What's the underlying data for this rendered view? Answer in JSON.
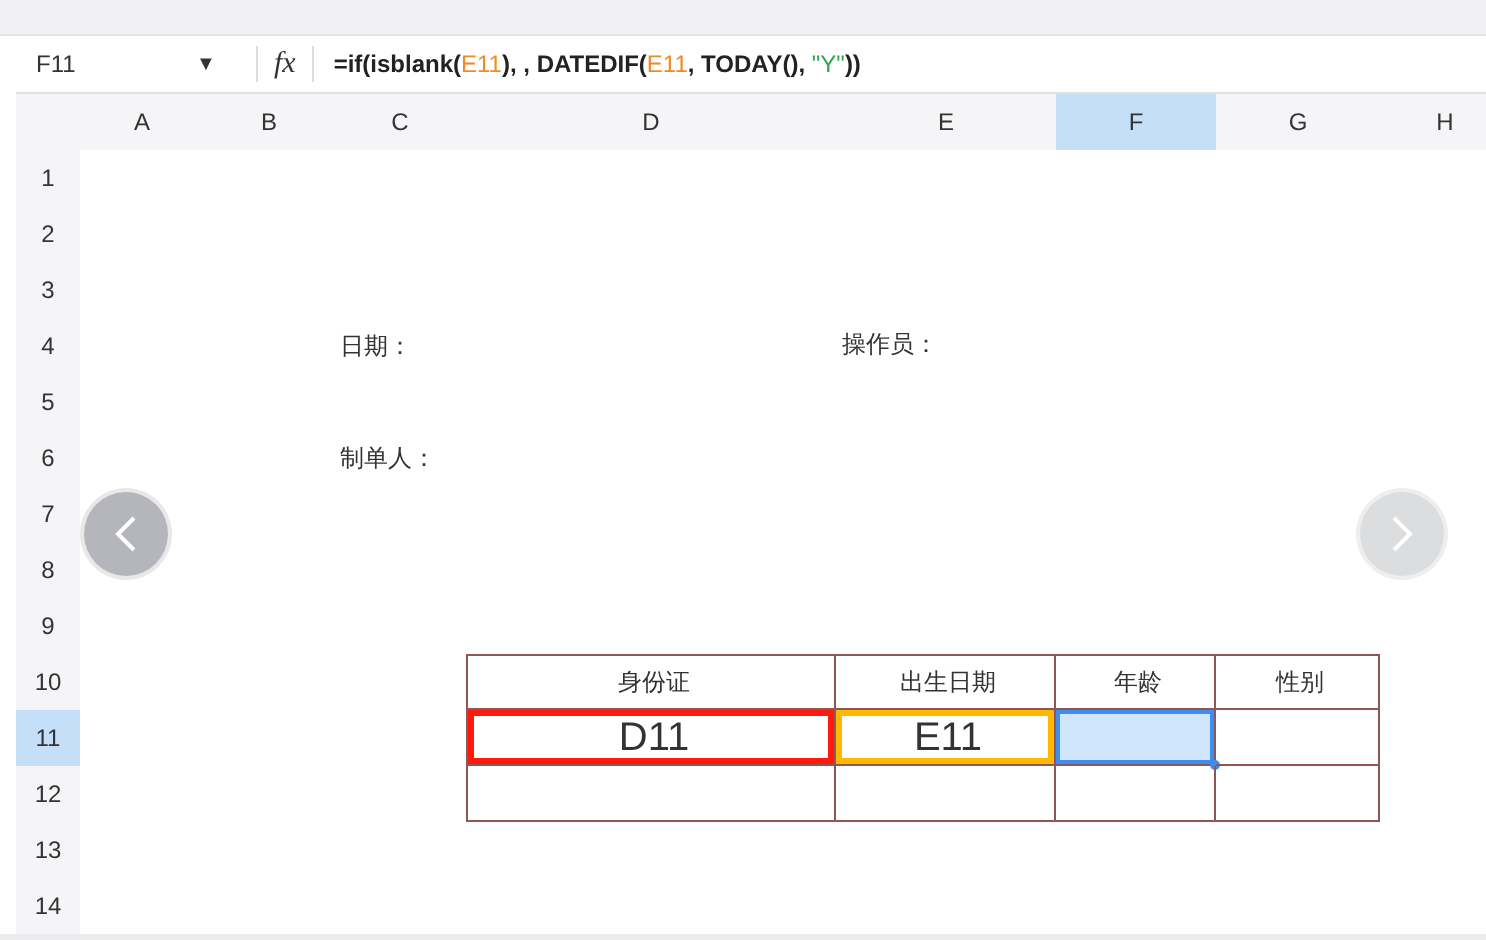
{
  "formula_bar": {
    "name_box": "F11",
    "dropdown": "▼",
    "fx": "fx",
    "formula": [
      {
        "kind": "plain",
        "text": "=if(isblank("
      },
      {
        "kind": "ref",
        "text": "E11"
      },
      {
        "kind": "plain",
        "text": "), , DATEDIF("
      },
      {
        "kind": "ref",
        "text": "E11"
      },
      {
        "kind": "plain",
        "text": ", TODAY(), "
      },
      {
        "kind": "string",
        "text": "\"Y\""
      },
      {
        "kind": "plain",
        "text": "))"
      }
    ]
  },
  "columns": [
    {
      "label": "A",
      "selected": false
    },
    {
      "label": "B",
      "selected": false
    },
    {
      "label": "C",
      "selected": false
    },
    {
      "label": "D",
      "selected": false
    },
    {
      "label": "E",
      "selected": false
    },
    {
      "label": "F",
      "selected": true
    },
    {
      "label": "G",
      "selected": false
    },
    {
      "label": "H",
      "selected": false
    }
  ],
  "rows": [
    {
      "label": "1",
      "selected": false,
      "cells": []
    },
    {
      "label": "2",
      "selected": false,
      "cells": []
    },
    {
      "label": "3",
      "selected": false,
      "cells": []
    },
    {
      "label": "4",
      "selected": false,
      "cells": [
        null,
        null,
        {
          "text": "日期："
        },
        null,
        {
          "text": "操作员："
        }
      ]
    },
    {
      "label": "5",
      "selected": false,
      "cells": []
    },
    {
      "label": "6",
      "selected": false,
      "cells": [
        null,
        null,
        {
          "text": "制单人："
        }
      ]
    },
    {
      "label": "7",
      "selected": false,
      "cells": []
    },
    {
      "label": "8",
      "selected": false,
      "cells": []
    },
    {
      "label": "9",
      "selected": false,
      "cells": []
    },
    {
      "label": "10",
      "selected": false,
      "cells": [
        null,
        null,
        null,
        {
          "kind": "bordered",
          "text": "身份证"
        },
        {
          "kind": "bordered",
          "text": "出生日期"
        },
        {
          "kind": "bordered",
          "text": "年龄"
        },
        {
          "kind": "bordered",
          "text": "性别"
        }
      ]
    },
    {
      "label": "11",
      "selected": true,
      "cells": [
        null,
        null,
        null,
        {
          "kind": "bordered",
          "text": "D11",
          "large": true,
          "color": "#ff1a0d"
        },
        {
          "kind": "bordered",
          "text": "E11",
          "large": true,
          "color": "#ffb800"
        },
        {
          "kind": "bordered",
          "selected": true
        },
        {
          "kind": "bordered"
        }
      ]
    },
    {
      "label": "12",
      "selected": false,
      "cells": [
        null,
        null,
        null,
        {
          "kind": "bordered"
        },
        {
          "kind": "bordered"
        },
        {
          "kind": "bordered"
        },
        {
          "kind": "bordered"
        }
      ]
    },
    {
      "label": "13",
      "selected": false,
      "cells": []
    },
    {
      "label": "14",
      "selected": false,
      "cells": []
    }
  ],
  "nav": {
    "previous_enabled": true,
    "next_enabled": false
  }
}
